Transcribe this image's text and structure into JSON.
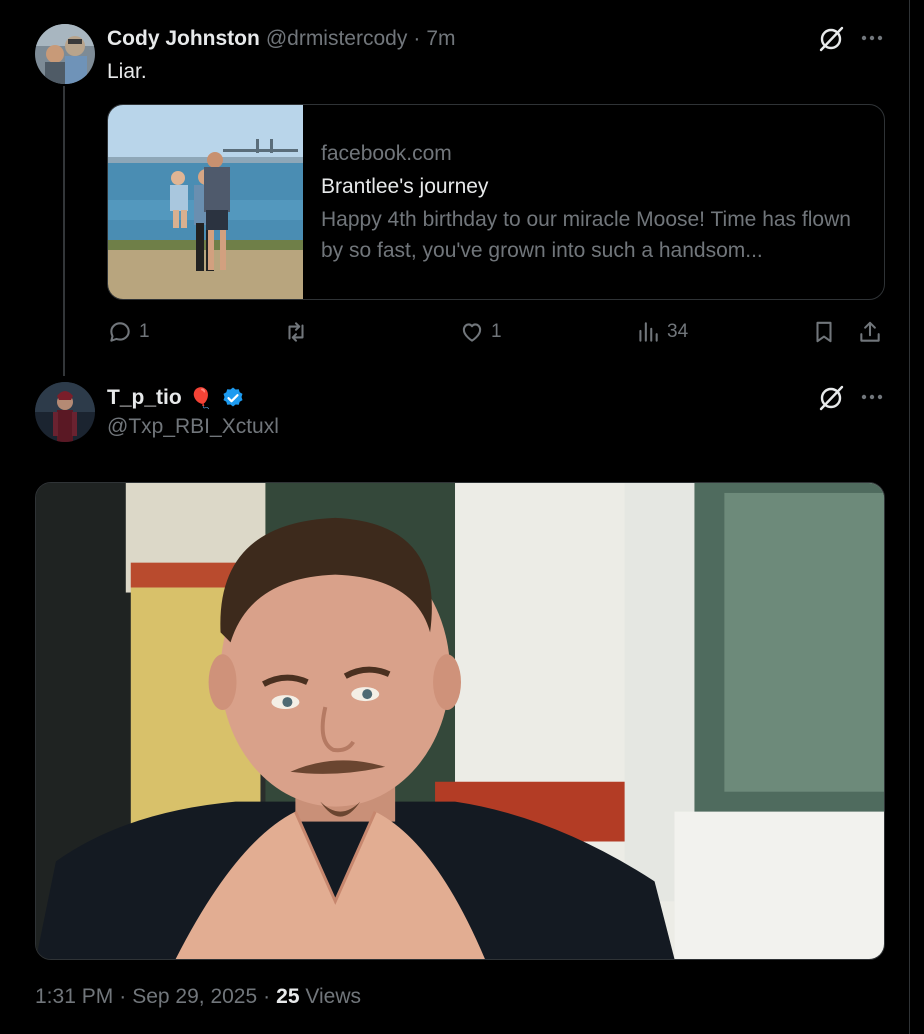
{
  "reply": {
    "author_name": "Cody Johnston",
    "author_handle": "@drmistercody",
    "separator": "·",
    "time": "7m",
    "text": "Liar.",
    "link_card": {
      "domain": "facebook.com",
      "title": "Brantlee's journey",
      "description": "Happy 4th birthday to our miracle Moose! Time has flown by so fast, you've grown into such a handsom..."
    },
    "actions": {
      "replies": "1",
      "reposts": "",
      "likes": "1",
      "views": "34"
    }
  },
  "main_post": {
    "author_name": "T_p_tio",
    "author_emoji": "🎈",
    "author_handle": "@Txp_RBI_Xctuxl",
    "timestamp_time": "1:31 PM",
    "separator": "·",
    "timestamp_date": "Sep 29, 2025",
    "views_count": "25",
    "views_label": "Views"
  },
  "icons": {
    "grok": "grok-icon",
    "more": "more-icon",
    "reply": "reply-icon",
    "repost": "repost-icon",
    "like": "heart-icon",
    "views": "views-chart-icon",
    "bookmark": "bookmark-icon",
    "share": "share-icon",
    "verified": "verified-badge-icon"
  },
  "colors": {
    "background": "#000000",
    "text_primary": "#e7e9ea",
    "text_secondary": "#71767b",
    "border": "#2f3336",
    "verified_blue": "#1d9bf0",
    "balloon_red": "#f91880"
  }
}
